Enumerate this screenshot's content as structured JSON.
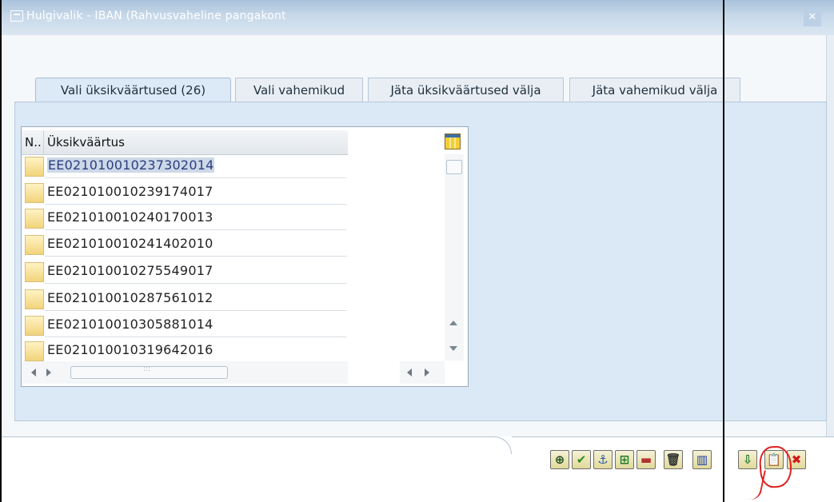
{
  "window": {
    "title": "Hulgivalik - IBAN (Rahvusvaheline pangakont",
    "close_symbol": "✕"
  },
  "tabs": [
    {
      "label": "Vali üksikväärtused (26)",
      "active": true
    },
    {
      "label": "Vali vahemikud",
      "active": false
    },
    {
      "label": "Jäta üksikväärtused välja",
      "active": false
    },
    {
      "label": "Jäta vahemikud välja",
      "active": false
    }
  ],
  "grid": {
    "col_n": "N..",
    "col_value": "Üksikväärtus",
    "rows": [
      "EE021010010237302014",
      "EE021010010239174017",
      "EE021010010240170013",
      "EE021010010241402010",
      "EE021010010275549017",
      "EE021010010287561012",
      "EE021010010305881014",
      "EE021010010319642016"
    ],
    "selected_row_index": 0
  },
  "toolbar": [
    {
      "name": "execute-icon",
      "glyph": "⊕",
      "color": "#1c4a1c"
    },
    {
      "name": "checkmark-icon",
      "glyph": "✔",
      "color": "#2f8f1c"
    },
    {
      "name": "execute-search-icon",
      "glyph": "⚓",
      "color": "#2a56a8"
    },
    {
      "name": "add-line-icon",
      "glyph": "⊞",
      "color": "#1f7a2d"
    },
    {
      "name": "delete-line-icon",
      "glyph": "▬",
      "color": "#b23232"
    },
    {
      "name": "trash-icon",
      "glyph": "🗑",
      "color": "#333333"
    },
    {
      "name": "import-text-icon",
      "glyph": "▥",
      "color": "#1d3ea8"
    },
    {
      "name": "upload-clipboard-icon",
      "glyph": "⇩",
      "color": "#1f7a2d"
    },
    {
      "name": "paste-clipboard-icon",
      "glyph": "📋",
      "color": "#8a6b1f"
    },
    {
      "name": "cancel-icon",
      "glyph": "✖",
      "color": "#d01818"
    }
  ],
  "colors": {
    "title_bar": "#c7d8e9",
    "tab_panel": "#dbe8f5",
    "annotation_red": "#e02020"
  }
}
